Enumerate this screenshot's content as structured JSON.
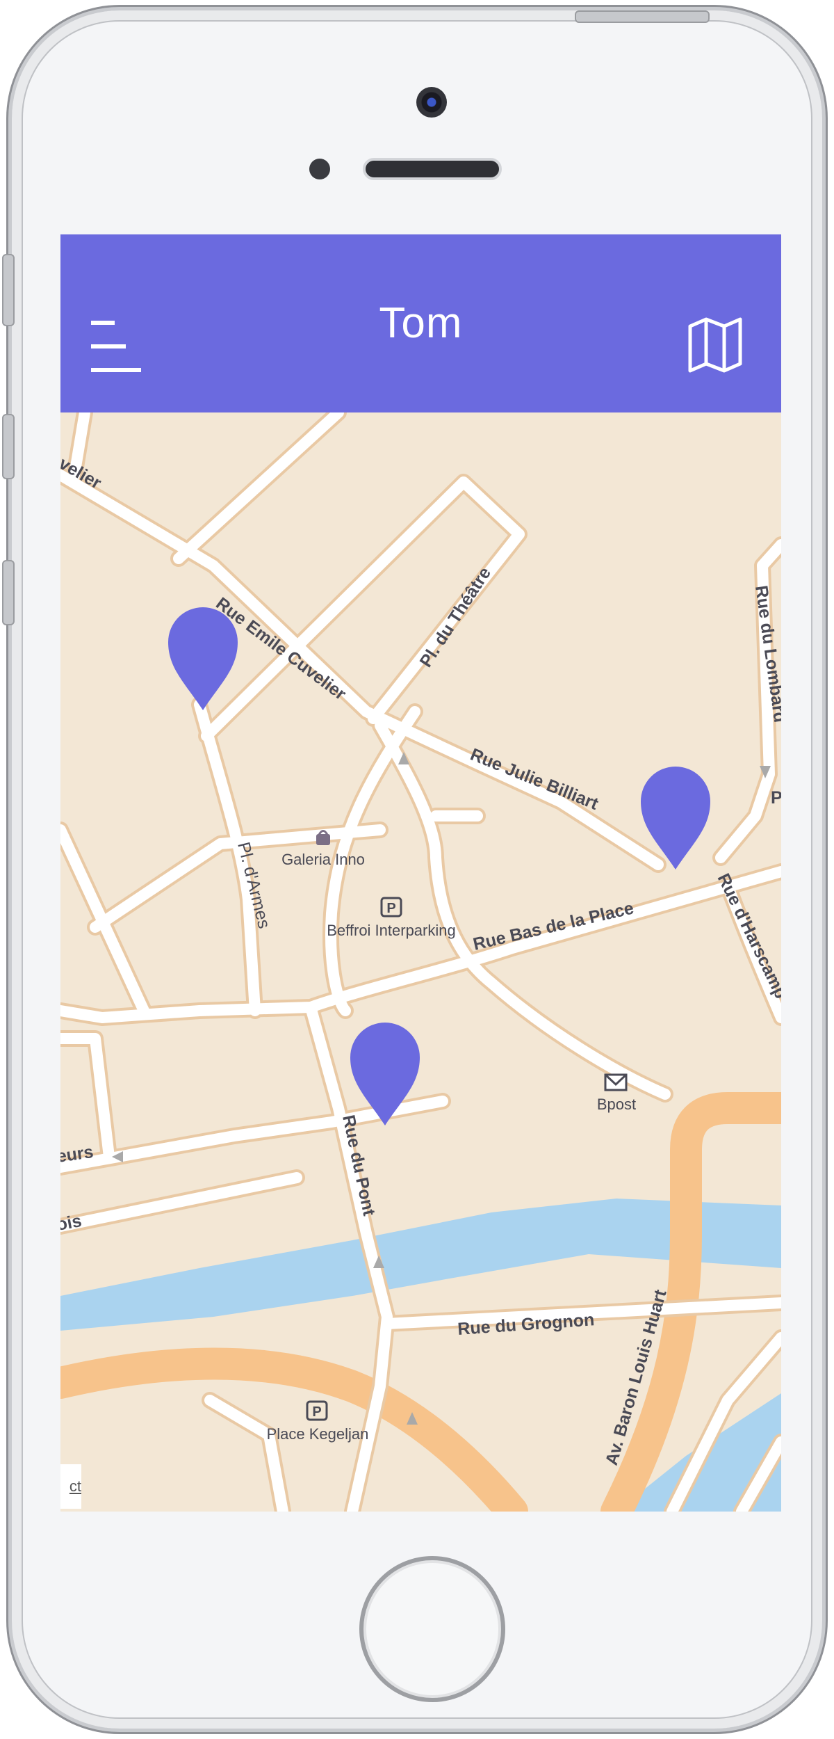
{
  "app": {
    "title": "Tom"
  },
  "colors": {
    "accent": "#6b6adf",
    "map_land": "#f3e7d5",
    "map_water": "#aad3ef",
    "map_road": "#f7c38b"
  },
  "header": {
    "menu_icon": "menu-icon",
    "map_icon": "map-icon"
  },
  "map": {
    "street_labels": {
      "emile_cuvelier": "Rue Emile Cuvelier",
      "velier": "velier",
      "theatre": "Pl. du Théâtre",
      "julie_billiart": "Rue Julie Billiart",
      "lombard": "Rue du Lombard",
      "harscamp": "Rue d'Harscamp",
      "armes": "Pl. d'Armes",
      "bas_de_la_place": "Rue Bas de la Place",
      "pont": "Rue du Pont",
      "grognon": "Rue du Grognon",
      "baron_huart": "Av. Baron Louis Huart",
      "eurs": "eurs",
      "ois": "ois",
      "p_edge": "P"
    },
    "pois": {
      "galeria": "Galeria Inno",
      "beffroi": "Beffroi Interparking",
      "bpost": "Bpost",
      "kegeljan": "Place Kegeljan"
    },
    "attribution": "ct",
    "markers": [
      "marker-1",
      "marker-2",
      "marker-3"
    ]
  }
}
